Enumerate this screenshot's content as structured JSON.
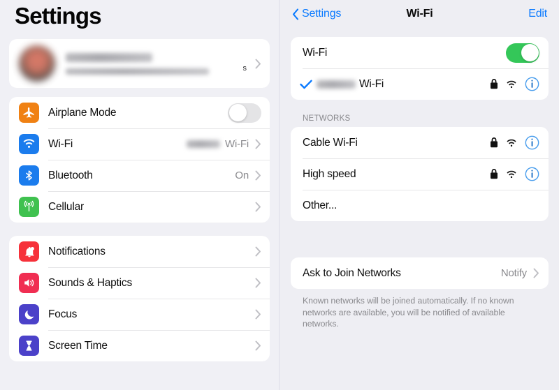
{
  "left": {
    "title": "Settings",
    "profile": {
      "name_redacted": true,
      "subtitle_redacted": true,
      "subtitle_tail": "s",
      "chevron": "chevron-right"
    },
    "group1": [
      {
        "label": "Airplane Mode",
        "icon": "airplane-icon",
        "icon_color": "#f08113",
        "control": "toggle",
        "toggle_on": false
      },
      {
        "label": "Wi-Fi",
        "icon": "wifi-icon",
        "icon_color": "#1b7ced",
        "value_redacted": true,
        "value": "Wi-Fi",
        "control": "chevron"
      },
      {
        "label": "Bluetooth",
        "icon": "bluetooth-icon",
        "icon_color": "#1b7ced",
        "value": "On",
        "control": "chevron"
      },
      {
        "label": "Cellular",
        "icon": "cellular-icon",
        "icon_color": "#3fc14f",
        "value": "",
        "control": "chevron"
      }
    ],
    "group2": [
      {
        "label": "Notifications",
        "icon": "bell-icon",
        "icon_color": "#f6313a",
        "control": "chevron"
      },
      {
        "label": "Sounds & Haptics",
        "icon": "speaker-icon",
        "icon_color": "#f02e52",
        "control": "chevron"
      },
      {
        "label": "Focus",
        "icon": "moon-icon",
        "icon_color": "#4b41c9",
        "control": "chevron"
      },
      {
        "label": "Screen Time",
        "icon": "hourglass-icon",
        "icon_color": "#4b41c9",
        "control": "chevron"
      }
    ]
  },
  "right": {
    "nav": {
      "back_label": "Settings",
      "back_icon": "chevron-left-icon",
      "title": "Wi-Fi",
      "edit_label": "Edit"
    },
    "wifi_toggle": {
      "label": "Wi-Fi",
      "on": true
    },
    "connected": {
      "ssid_redacted": true,
      "ssid_suffix": "Wi-Fi",
      "checkmark": true,
      "locked": true,
      "signal": "wifi-signal-icon",
      "info": "info-icon"
    },
    "networks_header": "NETWORKS",
    "networks": [
      {
        "name": "Cable Wi-Fi",
        "locked": true,
        "signal": "wifi-signal-icon",
        "info": "info-icon"
      },
      {
        "name": "High speed",
        "locked": true,
        "signal": "wifi-signal-icon",
        "info": "info-icon"
      },
      {
        "name": "Other...",
        "locked": false,
        "signal": null,
        "info": null
      }
    ],
    "ask_to_join": {
      "label": "Ask to Join Networks",
      "value": "Notify",
      "chevron": "chevron-right-icon"
    },
    "footer": "Known networks will be joined automatically. If no known networks are available, you will be notified of available networks."
  },
  "colors": {
    "accent_blue": "#0a7aff",
    "toggle_on_green": "#34c759",
    "secondary_text": "#8a8a8e",
    "panel_bg": "#f0f0f5",
    "card_bg": "#ffffff"
  }
}
